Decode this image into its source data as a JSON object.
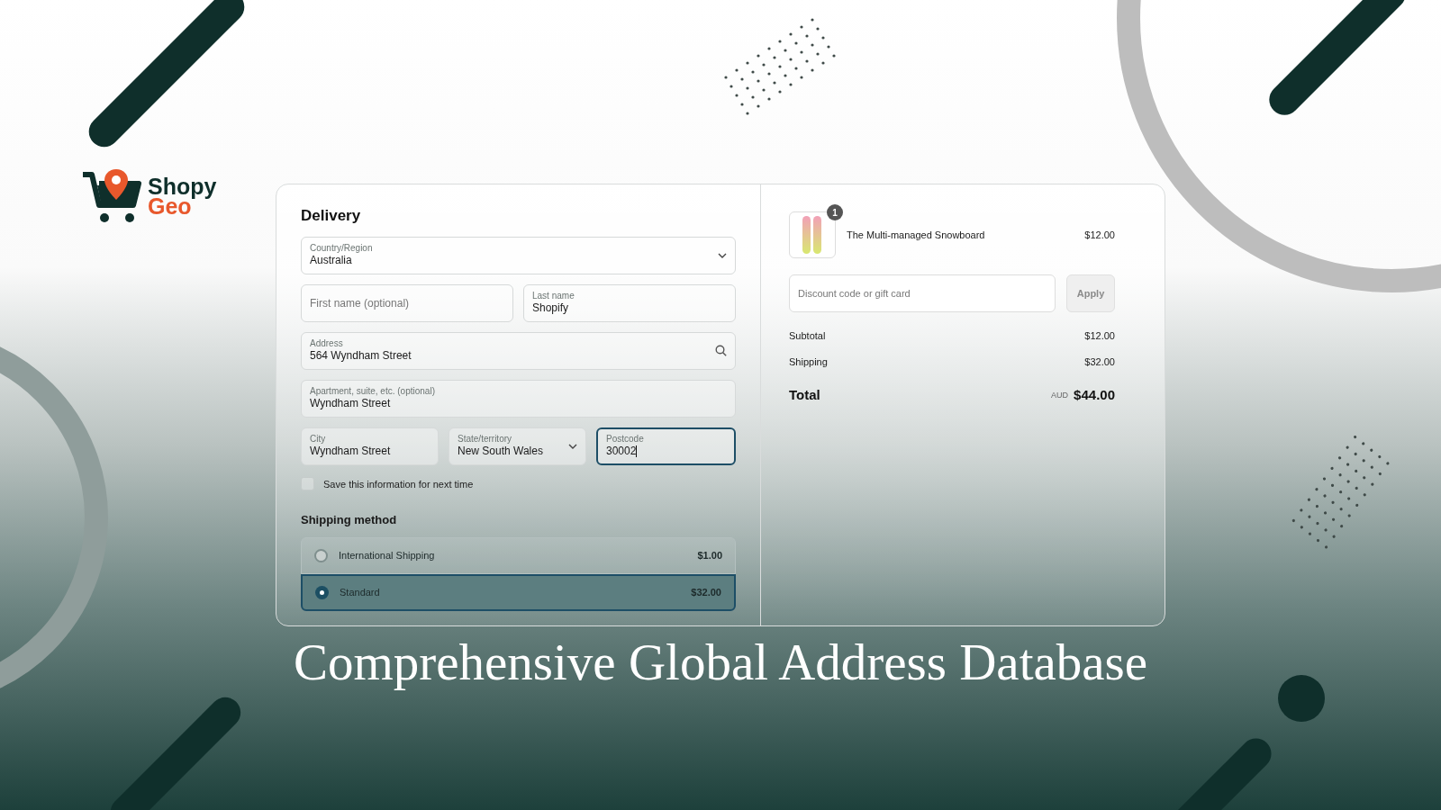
{
  "brand": {
    "line_1": "Shopy",
    "line_2": "Geo"
  },
  "delivery": {
    "title": "Delivery",
    "field_rows": [
      [
        {
          "kind": "select",
          "label": "Country/Region",
          "value": "Australia",
          "focused": false
        }
      ],
      [
        {
          "kind": "text",
          "placeholder": "First name (optional)",
          "focused": false
        },
        {
          "kind": "text",
          "label": "Last name",
          "value": "Shopify",
          "focused": false
        }
      ],
      [
        {
          "kind": "search",
          "label": "Address",
          "value": "564 Wyndham Street",
          "focused": false
        }
      ],
      [
        {
          "kind": "text",
          "label": "Apartment, suite, etc. (optional)",
          "value": "Wyndham Street",
          "focused": false
        }
      ],
      [
        {
          "kind": "text",
          "label": "City",
          "value": "Wyndham Street",
          "focused": false
        },
        {
          "kind": "select",
          "label": "State/territory",
          "value": "New South Wales",
          "focused": false
        },
        {
          "kind": "text",
          "label": "Postcode",
          "value": "30002",
          "focused": true
        }
      ]
    ],
    "save_info": {
      "label": "Save this information for next time",
      "checked": false
    },
    "shipping_title": "Shipping method",
    "shipping_options": [
      {
        "name": "International Shipping",
        "price": "$1.00",
        "selected": false
      },
      {
        "name": "Standard",
        "price": "$32.00",
        "selected": true
      }
    ]
  },
  "summary": {
    "item": {
      "quantity": "1",
      "name": "The Multi-managed Snowboard",
      "price": "$12.00"
    },
    "discount": {
      "placeholder": "Discount code or gift card",
      "button": "Apply"
    },
    "lines": [
      {
        "label": "Subtotal",
        "value": "$12.00"
      },
      {
        "label": "Shipping",
        "value": "$32.00"
      }
    ],
    "total": {
      "label": "Total",
      "currency": "AUD",
      "amount": "$44.00"
    }
  },
  "headline": "Comprehensive Global Address Database"
}
